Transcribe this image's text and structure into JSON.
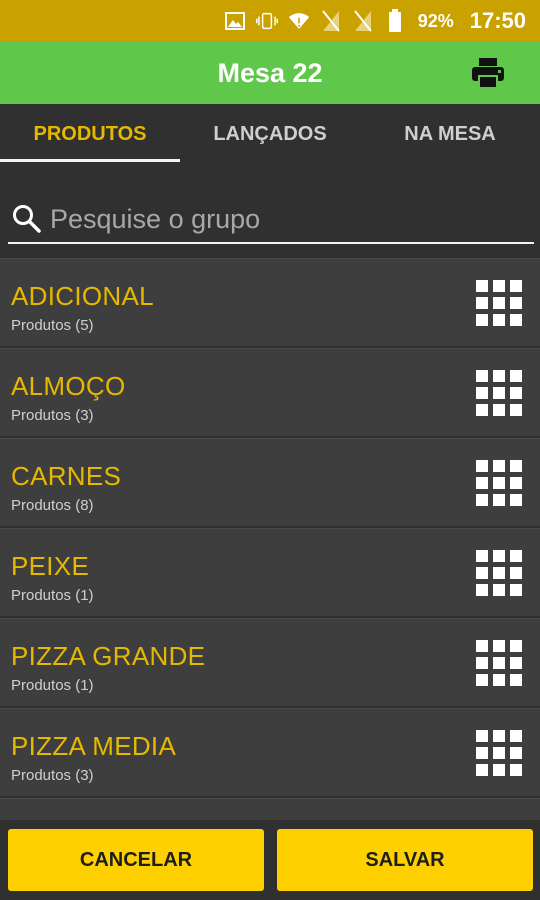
{
  "status_bar": {
    "battery": "92%",
    "time": "17:50",
    "icons": [
      "image-icon",
      "vibrate-icon",
      "wifi-icon",
      "no-sim-icon",
      "no-sim-icon",
      "battery-icon"
    ]
  },
  "app_bar": {
    "title": "Mesa 22",
    "print_icon": "printer-icon",
    "color": "#5fc74a"
  },
  "tabs": [
    {
      "label": "PRODUTOS",
      "active": true
    },
    {
      "label": "LANÇADOS",
      "active": false
    },
    {
      "label": "NA MESA",
      "active": false
    }
  ],
  "search": {
    "placeholder": "Pesquise o grupo",
    "value": ""
  },
  "groups": [
    {
      "name": "ADICIONAL",
      "count": "Produtos (5)"
    },
    {
      "name": "ALMOÇO",
      "count": "Produtos (3)"
    },
    {
      "name": "CARNES",
      "count": "Produtos (8)"
    },
    {
      "name": "PEIXE",
      "count": "Produtos (1)"
    },
    {
      "name": "PIZZA GRANDE",
      "count": "Produtos (1)"
    },
    {
      "name": "PIZZA MEDIA",
      "count": "Produtos (3)"
    }
  ],
  "buttons": {
    "cancel": "CANCELAR",
    "save": "SALVAR"
  },
  "colors": {
    "status_bar": "#c9a200",
    "accent": "#e6b800",
    "button": "#ffd000",
    "background": "#303030"
  }
}
